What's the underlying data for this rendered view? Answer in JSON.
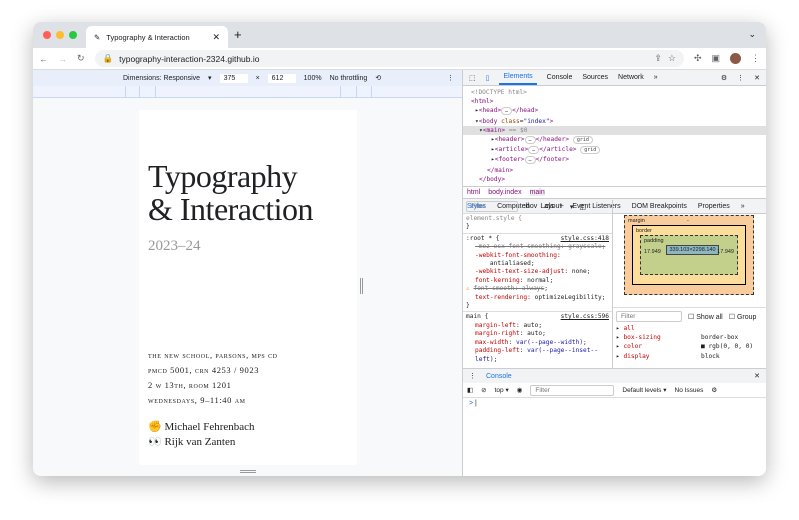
{
  "browser": {
    "tab_title": "Typography & Interaction",
    "url": "typography-interaction-2324.github.io"
  },
  "device_toolbar": {
    "dimensions": "Dimensions: Responsive",
    "width": "375",
    "x": "×",
    "height": "612",
    "zoom": "100%",
    "throttling": "No throttling"
  },
  "page": {
    "title_line1": "Typography",
    "title_line2": "& Interaction",
    "year": "2023–24",
    "info": [
      "The New School, Parsons, MPS CD",
      "PMCD 5001, CRN 4253 / 9023",
      "2 W 13th, Room 1201",
      "Wednesdays, 9–11:40 AM"
    ],
    "people": [
      {
        "emoji": "✊",
        "name": "Michael Fehrenbach"
      },
      {
        "emoji": "👀",
        "name": "Rijk van Zanten"
      }
    ]
  },
  "devtools": {
    "tabs": [
      "Elements",
      "Console",
      "Sources",
      "Network"
    ],
    "dom": {
      "doctype": "<!DOCTYPE html>",
      "html": "<html>",
      "head": "<head>",
      "head_close": "</head>",
      "body_open": "<body",
      "class_attr": "class",
      "class_val": "\"index\"",
      "main": "<main>",
      "main_eq": "== $0",
      "header": "<header>",
      "header_close": "</header>",
      "article": "<article>",
      "article_close": "</article>",
      "footer": "<footer>",
      "footer_close": "</footer>",
      "main_close": "</main>",
      "body_close": "</body>",
      "grid": "grid"
    },
    "breadcrumbs": [
      "html",
      "body.index",
      "main"
    ],
    "style_tabs": [
      "Styles",
      "Computed",
      "Layout",
      "Event Listeners",
      "DOM Breakpoints",
      "Properties"
    ],
    "filter_placeholder": "Filter",
    "hov": ":hov",
    "cls": ".cls",
    "element_style": "element.style {",
    "close_brace": "}",
    "root_rule": {
      "selector": ":root * {",
      "source": "style.css:418",
      "decls": [
        [
          "-moz-osx-font-smoothing",
          "grayscale"
        ],
        [
          "-webkit-font-smoothing",
          "antialiased"
        ],
        [
          "-webkit-text-size-adjust",
          "none"
        ],
        [
          "font-kerning",
          "normal"
        ],
        [
          "font-smooth",
          "always"
        ],
        [
          "text-rendering",
          "optimizeLegibility"
        ]
      ]
    },
    "main_rule": {
      "selector": "main {",
      "source": "style.css:596",
      "decls": [
        [
          "margin-left",
          "auto"
        ],
        [
          "margin-right",
          "auto"
        ],
        [
          "max-width",
          "var(--page--width)"
        ],
        [
          "padding-left",
          "var(--page--inset--left)"
        ]
      ]
    },
    "box_model": {
      "margin": "margin",
      "border": "border",
      "padding": "padding",
      "content": "339.103×2298.140",
      "padding_left": "17.949",
      "padding_right": "17.949",
      "dash": "-"
    },
    "computed": {
      "show_all": "Show all",
      "group": "Group",
      "props": [
        [
          "all",
          ""
        ],
        [
          "box-sizing",
          "border-box"
        ],
        [
          "color",
          "rgb(0, 0, 0)"
        ],
        [
          "display",
          "block"
        ]
      ]
    },
    "console": {
      "title": "Console",
      "context": "top",
      "levels": "Default levels",
      "issues": "No Issues",
      "prompt": ">"
    }
  }
}
